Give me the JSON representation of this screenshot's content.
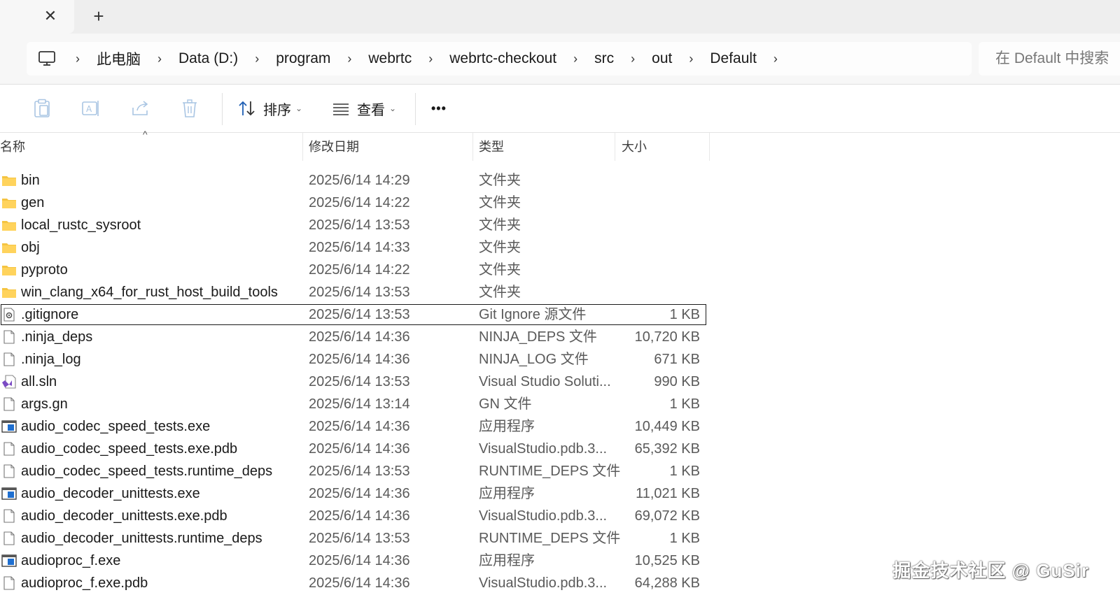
{
  "tabs": {
    "close_glyph": "✕",
    "new_glyph": "+"
  },
  "address": {
    "crumbs": [
      "此电脑",
      "Data (D:)",
      "program",
      "webrtc",
      "webrtc-checkout",
      "src",
      "out",
      "Default"
    ],
    "separator": "›"
  },
  "search": {
    "placeholder": "在 Default 中搜索"
  },
  "toolbar": {
    "icons": [
      "paste-icon",
      "rename-icon",
      "share-icon",
      "delete-icon"
    ],
    "sort_label": "排序",
    "view_label": "查看",
    "more_label": "•••"
  },
  "columns": {
    "name": "名称",
    "date": "修改日期",
    "type": "类型",
    "size": "大小"
  },
  "files": [
    {
      "icon": "folder",
      "name": "bin",
      "date": "2025/6/14 14:29",
      "type": "文件夹",
      "size": ""
    },
    {
      "icon": "folder",
      "name": "gen",
      "date": "2025/6/14 14:22",
      "type": "文件夹",
      "size": ""
    },
    {
      "icon": "folder",
      "name": "local_rustc_sysroot",
      "date": "2025/6/14 13:53",
      "type": "文件夹",
      "size": ""
    },
    {
      "icon": "folder",
      "name": "obj",
      "date": "2025/6/14 14:33",
      "type": "文件夹",
      "size": ""
    },
    {
      "icon": "folder",
      "name": "pyproto",
      "date": "2025/6/14 14:22",
      "type": "文件夹",
      "size": ""
    },
    {
      "icon": "folder",
      "name": "win_clang_x64_for_rust_host_build_tools",
      "date": "2025/6/14 13:53",
      "type": "文件夹",
      "size": ""
    },
    {
      "icon": "config",
      "name": ".gitignore",
      "date": "2025/6/14 13:53",
      "type": "Git Ignore 源文件",
      "size": "1 KB",
      "selected": true
    },
    {
      "icon": "file",
      "name": ".ninja_deps",
      "date": "2025/6/14 14:36",
      "type": "NINJA_DEPS 文件",
      "size": "10,720 KB"
    },
    {
      "icon": "file",
      "name": ".ninja_log",
      "date": "2025/6/14 14:36",
      "type": "NINJA_LOG 文件",
      "size": "671 KB"
    },
    {
      "icon": "vs",
      "name": "all.sln",
      "date": "2025/6/14 13:53",
      "type": "Visual Studio Soluti...",
      "size": "990 KB"
    },
    {
      "icon": "file",
      "name": "args.gn",
      "date": "2025/6/14 13:14",
      "type": "GN 文件",
      "size": "1 KB"
    },
    {
      "icon": "exe",
      "name": "audio_codec_speed_tests.exe",
      "date": "2025/6/14 14:36",
      "type": "应用程序",
      "size": "10,449 KB"
    },
    {
      "icon": "file",
      "name": "audio_codec_speed_tests.exe.pdb",
      "date": "2025/6/14 14:36",
      "type": "VisualStudio.pdb.3...",
      "size": "65,392 KB"
    },
    {
      "icon": "file",
      "name": "audio_codec_speed_tests.runtime_deps",
      "date": "2025/6/14 13:53",
      "type": "RUNTIME_DEPS 文件",
      "size": "1 KB"
    },
    {
      "icon": "exe",
      "name": "audio_decoder_unittests.exe",
      "date": "2025/6/14 14:36",
      "type": "应用程序",
      "size": "11,021 KB"
    },
    {
      "icon": "file",
      "name": "audio_decoder_unittests.exe.pdb",
      "date": "2025/6/14 14:36",
      "type": "VisualStudio.pdb.3...",
      "size": "69,072 KB"
    },
    {
      "icon": "file",
      "name": "audio_decoder_unittests.runtime_deps",
      "date": "2025/6/14 13:53",
      "type": "RUNTIME_DEPS 文件",
      "size": "1 KB"
    },
    {
      "icon": "exe",
      "name": "audioproc_f.exe",
      "date": "2025/6/14 14:36",
      "type": "应用程序",
      "size": "10,525 KB"
    },
    {
      "icon": "file",
      "name": "audioproc_f.exe.pdb",
      "date": "2025/6/14 14:36",
      "type": "VisualStudio.pdb.3...",
      "size": "64,288 KB"
    }
  ],
  "watermark": "掘金技术社区 @ GuSir",
  "colors": {
    "folder": "#f5c441",
    "exe_blue": "#1f6fd0",
    "vs_purple": "#7b4bc4",
    "selection_border": "#1a1a1a"
  }
}
